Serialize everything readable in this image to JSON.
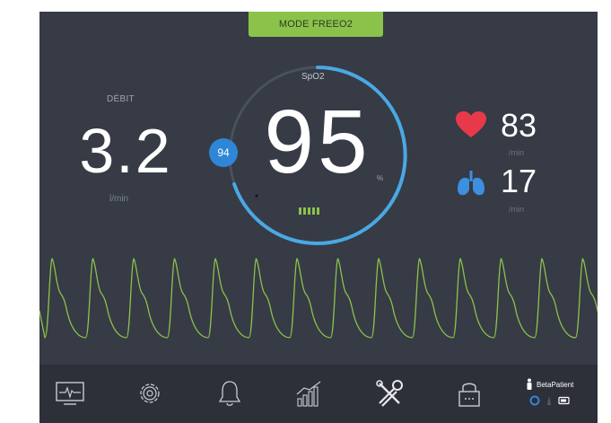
{
  "mode": {
    "label": "MODE FREEO2"
  },
  "debit": {
    "label": "DÉBIT",
    "value": "3.2",
    "unit": "l/min"
  },
  "spo2": {
    "label": "SpO2",
    "value": "95",
    "unit": "%",
    "target": "94",
    "signal_bars": 5
  },
  "heart_rate": {
    "value": "83",
    "unit": "/min",
    "icon": "heart-icon",
    "color": "#e8394a"
  },
  "resp_rate": {
    "value": "17",
    "unit": "/min",
    "icon": "lungs-icon",
    "color": "#3d8fe0"
  },
  "colors": {
    "background": "#363b46",
    "accent_green": "#8bc34a",
    "accent_blue": "#2f86d6",
    "toolbar": "#2d3039"
  },
  "toolbar": {
    "items": [
      {
        "icon": "monitor-icon"
      },
      {
        "icon": "settings-gear-icon"
      },
      {
        "icon": "alarm-bell-icon"
      },
      {
        "icon": "trends-chart-icon"
      },
      {
        "icon": "tools-icon"
      },
      {
        "icon": "lock-icon"
      }
    ],
    "patient": {
      "name": "BetaPatient"
    }
  }
}
